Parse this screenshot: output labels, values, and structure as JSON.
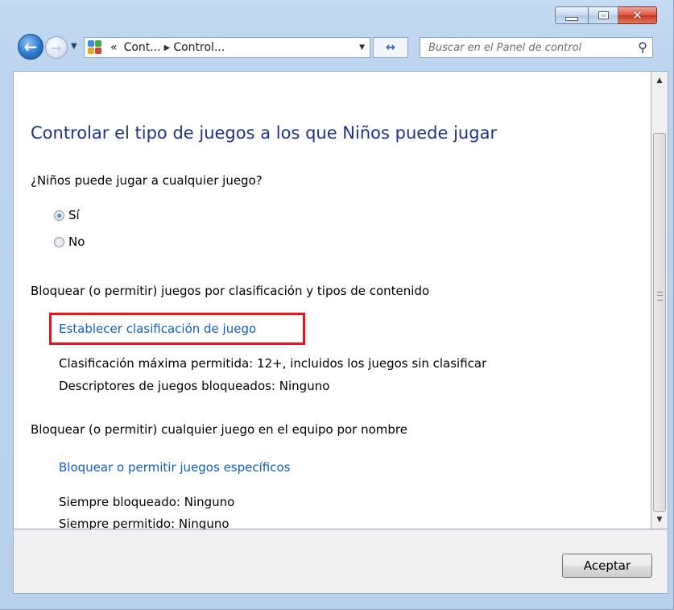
{
  "window": {
    "controls": {
      "minimize": "minimize",
      "maximize": "maximize",
      "close": "close"
    }
  },
  "nav": {
    "breadcrumb_prefix": "«",
    "breadcrumbs": [
      "Cont...",
      "Control..."
    ],
    "search_placeholder": "Buscar en el Panel de control"
  },
  "page": {
    "title": "Controlar el tipo de juegos a los que Niños puede jugar",
    "question": "¿Niños puede jugar a cualquier juego?",
    "options": [
      {
        "label": "Sí",
        "selected": true
      },
      {
        "label": "No",
        "selected": false
      }
    ],
    "section1": {
      "heading": "Bloquear (o permitir) juegos por clasificación y tipos de contenido",
      "link": "Establecer clasificación de juego",
      "rating_label": "Clasificación máxima permitida:",
      "rating_value": "12+, incluidos los juegos sin clasificar",
      "descriptors_label": "Descriptores de juegos bloqueados:",
      "descriptors_value": "Ninguno"
    },
    "section2": {
      "heading": "Bloquear (o permitir) cualquier juego en el equipo por nombre",
      "link": "Bloquear o permitir juegos específicos",
      "blocked_label": "Siempre bloqueado:",
      "blocked_value": "Ninguno",
      "allowed_label": "Siempre permitido:",
      "allowed_value": "Ninguno"
    }
  },
  "footer": {
    "ok_label": "Aceptar"
  },
  "colors": {
    "title": "#1e3287",
    "link": "#0d5fc2",
    "highlight_box": "#e8141a",
    "close_button": "#c7361d"
  }
}
